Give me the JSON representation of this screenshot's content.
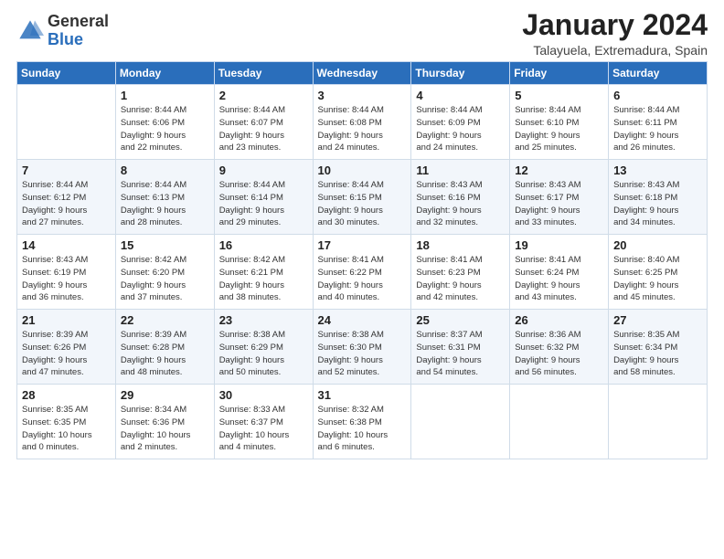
{
  "header": {
    "logo_general": "General",
    "logo_blue": "Blue",
    "title": "January 2024",
    "subtitle": "Talayuela, Extremadura, Spain"
  },
  "days_of_week": [
    "Sunday",
    "Monday",
    "Tuesday",
    "Wednesday",
    "Thursday",
    "Friday",
    "Saturday"
  ],
  "weeks": [
    [
      {
        "num": "",
        "info": ""
      },
      {
        "num": "1",
        "info": "Sunrise: 8:44 AM\nSunset: 6:06 PM\nDaylight: 9 hours\nand 22 minutes."
      },
      {
        "num": "2",
        "info": "Sunrise: 8:44 AM\nSunset: 6:07 PM\nDaylight: 9 hours\nand 23 minutes."
      },
      {
        "num": "3",
        "info": "Sunrise: 8:44 AM\nSunset: 6:08 PM\nDaylight: 9 hours\nand 24 minutes."
      },
      {
        "num": "4",
        "info": "Sunrise: 8:44 AM\nSunset: 6:09 PM\nDaylight: 9 hours\nand 24 minutes."
      },
      {
        "num": "5",
        "info": "Sunrise: 8:44 AM\nSunset: 6:10 PM\nDaylight: 9 hours\nand 25 minutes."
      },
      {
        "num": "6",
        "info": "Sunrise: 8:44 AM\nSunset: 6:11 PM\nDaylight: 9 hours\nand 26 minutes."
      }
    ],
    [
      {
        "num": "7",
        "info": "Sunrise: 8:44 AM\nSunset: 6:12 PM\nDaylight: 9 hours\nand 27 minutes."
      },
      {
        "num": "8",
        "info": "Sunrise: 8:44 AM\nSunset: 6:13 PM\nDaylight: 9 hours\nand 28 minutes."
      },
      {
        "num": "9",
        "info": "Sunrise: 8:44 AM\nSunset: 6:14 PM\nDaylight: 9 hours\nand 29 minutes."
      },
      {
        "num": "10",
        "info": "Sunrise: 8:44 AM\nSunset: 6:15 PM\nDaylight: 9 hours\nand 30 minutes."
      },
      {
        "num": "11",
        "info": "Sunrise: 8:43 AM\nSunset: 6:16 PM\nDaylight: 9 hours\nand 32 minutes."
      },
      {
        "num": "12",
        "info": "Sunrise: 8:43 AM\nSunset: 6:17 PM\nDaylight: 9 hours\nand 33 minutes."
      },
      {
        "num": "13",
        "info": "Sunrise: 8:43 AM\nSunset: 6:18 PM\nDaylight: 9 hours\nand 34 minutes."
      }
    ],
    [
      {
        "num": "14",
        "info": "Sunrise: 8:43 AM\nSunset: 6:19 PM\nDaylight: 9 hours\nand 36 minutes."
      },
      {
        "num": "15",
        "info": "Sunrise: 8:42 AM\nSunset: 6:20 PM\nDaylight: 9 hours\nand 37 minutes."
      },
      {
        "num": "16",
        "info": "Sunrise: 8:42 AM\nSunset: 6:21 PM\nDaylight: 9 hours\nand 38 minutes."
      },
      {
        "num": "17",
        "info": "Sunrise: 8:41 AM\nSunset: 6:22 PM\nDaylight: 9 hours\nand 40 minutes."
      },
      {
        "num": "18",
        "info": "Sunrise: 8:41 AM\nSunset: 6:23 PM\nDaylight: 9 hours\nand 42 minutes."
      },
      {
        "num": "19",
        "info": "Sunrise: 8:41 AM\nSunset: 6:24 PM\nDaylight: 9 hours\nand 43 minutes."
      },
      {
        "num": "20",
        "info": "Sunrise: 8:40 AM\nSunset: 6:25 PM\nDaylight: 9 hours\nand 45 minutes."
      }
    ],
    [
      {
        "num": "21",
        "info": "Sunrise: 8:39 AM\nSunset: 6:26 PM\nDaylight: 9 hours\nand 47 minutes."
      },
      {
        "num": "22",
        "info": "Sunrise: 8:39 AM\nSunset: 6:28 PM\nDaylight: 9 hours\nand 48 minutes."
      },
      {
        "num": "23",
        "info": "Sunrise: 8:38 AM\nSunset: 6:29 PM\nDaylight: 9 hours\nand 50 minutes."
      },
      {
        "num": "24",
        "info": "Sunrise: 8:38 AM\nSunset: 6:30 PM\nDaylight: 9 hours\nand 52 minutes."
      },
      {
        "num": "25",
        "info": "Sunrise: 8:37 AM\nSunset: 6:31 PM\nDaylight: 9 hours\nand 54 minutes."
      },
      {
        "num": "26",
        "info": "Sunrise: 8:36 AM\nSunset: 6:32 PM\nDaylight: 9 hours\nand 56 minutes."
      },
      {
        "num": "27",
        "info": "Sunrise: 8:35 AM\nSunset: 6:34 PM\nDaylight: 9 hours\nand 58 minutes."
      }
    ],
    [
      {
        "num": "28",
        "info": "Sunrise: 8:35 AM\nSunset: 6:35 PM\nDaylight: 10 hours\nand 0 minutes."
      },
      {
        "num": "29",
        "info": "Sunrise: 8:34 AM\nSunset: 6:36 PM\nDaylight: 10 hours\nand 2 minutes."
      },
      {
        "num": "30",
        "info": "Sunrise: 8:33 AM\nSunset: 6:37 PM\nDaylight: 10 hours\nand 4 minutes."
      },
      {
        "num": "31",
        "info": "Sunrise: 8:32 AM\nSunset: 6:38 PM\nDaylight: 10 hours\nand 6 minutes."
      },
      {
        "num": "",
        "info": ""
      },
      {
        "num": "",
        "info": ""
      },
      {
        "num": "",
        "info": ""
      }
    ]
  ]
}
